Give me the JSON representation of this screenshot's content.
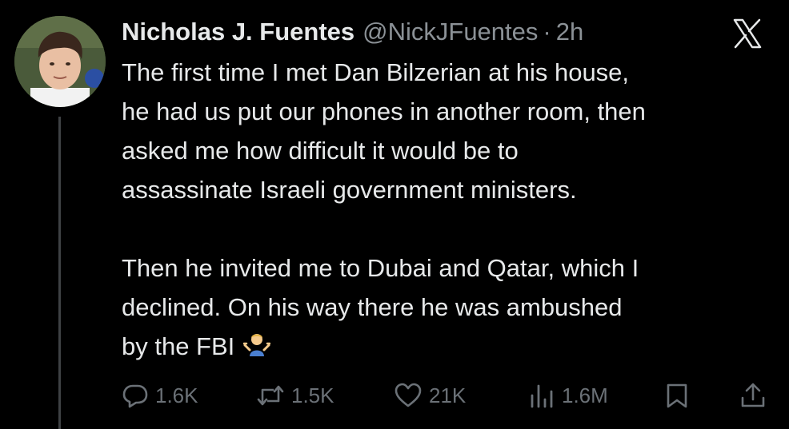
{
  "tweet": {
    "display_name": "Nicholas J. Fuentes",
    "handle": "@NickJFuentes",
    "separator": "·",
    "time": "2h",
    "paragraph_1": "The first time I met Dan Bilzerian at his house,\nhe had us put our phones in another room, then\nasked me how difficult it would be to\nassassinate Israeli government ministers.",
    "paragraph_2": "Then he invited me to Dubai and Qatar, which I\ndeclined. On his way there he was ambushed\nby the FBI",
    "emoji": "man-shrugging-emoji"
  },
  "actions": {
    "replies": "1.6K",
    "reposts": "1.5K",
    "likes": "21K",
    "views": "1.6M"
  },
  "icons": {
    "logo": "x-logo-icon",
    "reply": "reply-icon",
    "repost": "repost-icon",
    "like": "heart-icon",
    "views": "views-icon",
    "bookmark": "bookmark-icon",
    "share": "share-icon"
  },
  "colors": {
    "background": "#000000",
    "text_primary": "#e7e9ea",
    "text_secondary": "#8b9196",
    "action_gray": "#6b7177",
    "thread_line": "#3e4144"
  }
}
